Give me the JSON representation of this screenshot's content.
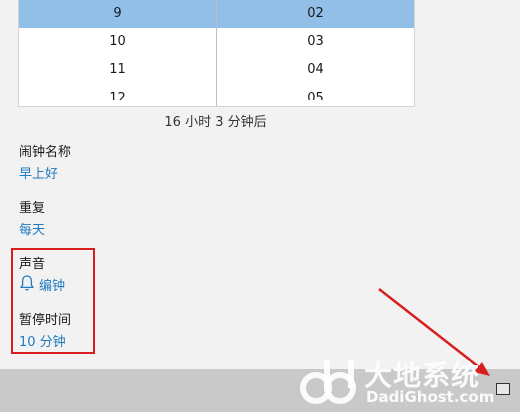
{
  "picker": {
    "hours": [
      "9",
      "10",
      "11",
      "12"
    ],
    "minutes": [
      "02",
      "03",
      "04",
      "05"
    ],
    "selected_hour": "9",
    "selected_minute": "02"
  },
  "countdown": "16 小时 3 分钟后",
  "alarm_name": {
    "label": "闹钟名称",
    "value": "早上好"
  },
  "repeat": {
    "label": "重复",
    "value": "每天"
  },
  "sound": {
    "label": "声音",
    "value": "编钟",
    "icon": "bell-icon"
  },
  "snooze": {
    "label": "暂停时间",
    "value": "10 分钟"
  },
  "watermark": {
    "cn": "大地系统",
    "en": "DadiGhost.com"
  },
  "colors": {
    "accent": "#1f7bbf",
    "selection": "#91bfe8",
    "highlight_border": "#d81e1e",
    "arrow": "#d81e1e"
  }
}
